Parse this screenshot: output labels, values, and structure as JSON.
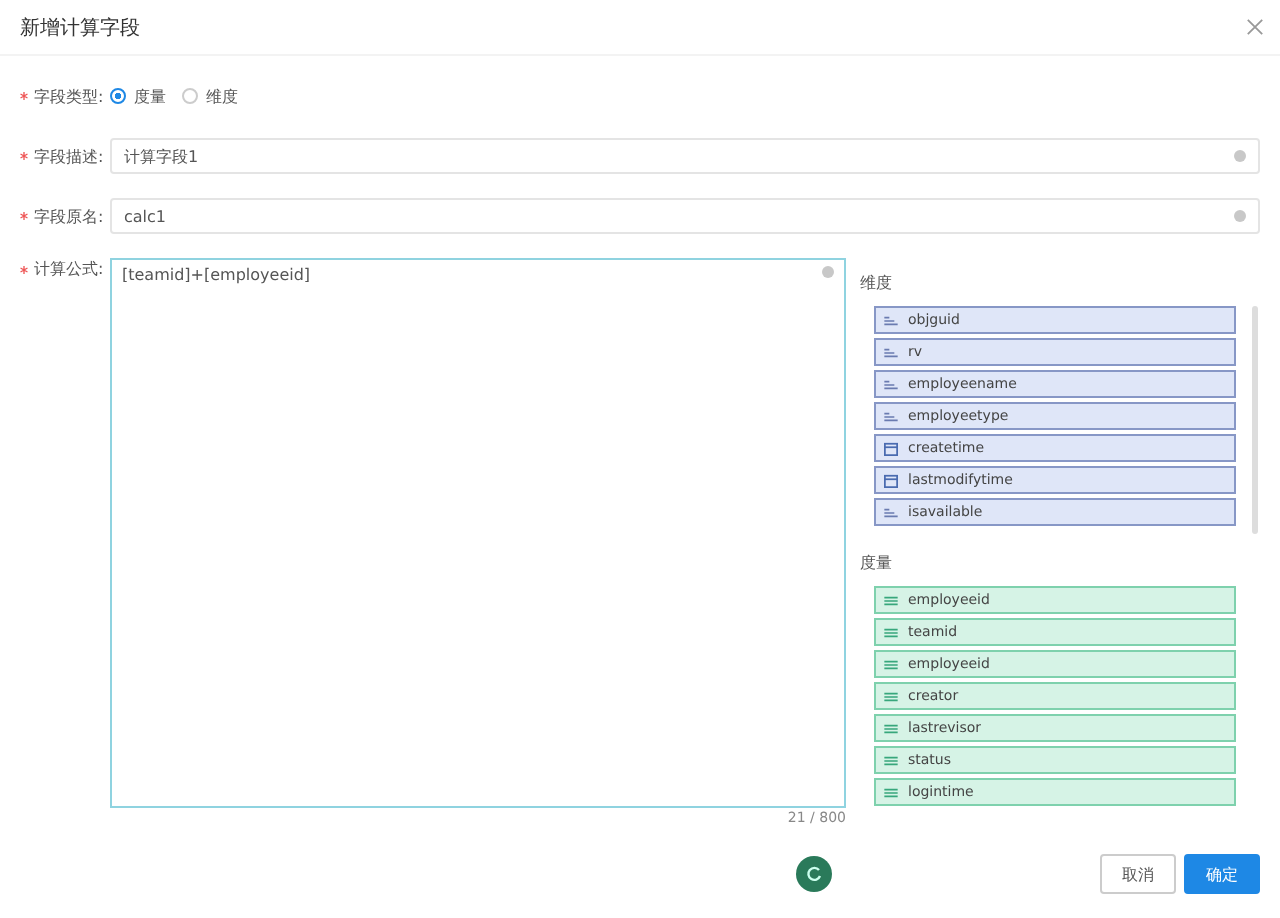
{
  "dialog": {
    "title": "新增计算字段"
  },
  "form": {
    "required": true,
    "type_label": "字段类型:",
    "type_options": [
      {
        "label": "度量",
        "selected": true
      },
      {
        "label": "维度",
        "selected": false
      }
    ],
    "desc_label": "字段描述:",
    "desc_value": "计算字段1",
    "name_label": "字段原名:",
    "name_value": "calc1",
    "formula_label": "计算公式:",
    "formula_value": "[teamid]+[employeeid]",
    "formula_counter": "21 / 800"
  },
  "field_groups": [
    {
      "title": "维度",
      "kind": "dimension",
      "scrollable": true,
      "fields": [
        {
          "name": "objguid",
          "kind": "text"
        },
        {
          "name": "rv",
          "kind": "text"
        },
        {
          "name": "employeename",
          "kind": "text"
        },
        {
          "name": "employeetype",
          "kind": "text"
        },
        {
          "name": "createtime",
          "kind": "date"
        },
        {
          "name": "lastmodifytime",
          "kind": "date"
        },
        {
          "name": "isavailable",
          "kind": "text"
        }
      ]
    },
    {
      "title": "度量",
      "kind": "measure",
      "scrollable": false,
      "fields": [
        {
          "name": "employeeid",
          "kind": "number"
        },
        {
          "name": "teamid",
          "kind": "number"
        },
        {
          "name": "employeeid",
          "kind": "number"
        },
        {
          "name": "creator",
          "kind": "number"
        },
        {
          "name": "lastrevisor",
          "kind": "number"
        },
        {
          "name": "status",
          "kind": "number"
        },
        {
          "name": "logintime",
          "kind": "number"
        }
      ]
    }
  ],
  "buttons": [
    {
      "label": "取消",
      "kind": "secondary"
    },
    {
      "label": "确定",
      "kind": "primary"
    }
  ]
}
